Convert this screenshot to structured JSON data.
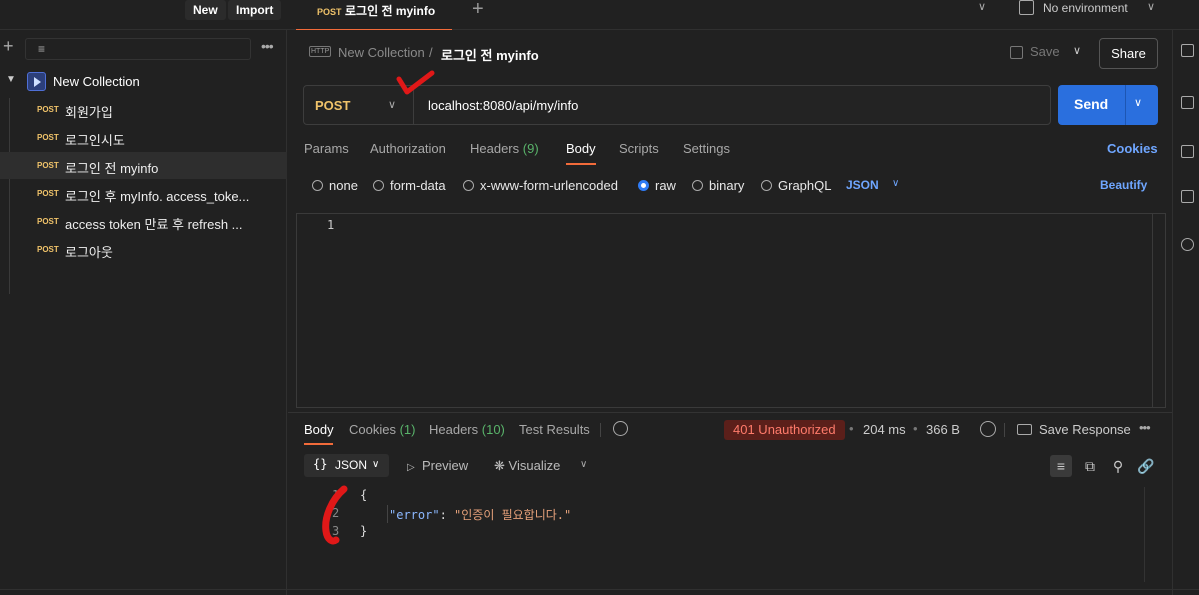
{
  "topbar": {
    "new_label": "New",
    "import_label": "Import",
    "active_tab": {
      "method": "POST",
      "title": "로그인 전 myinfo"
    },
    "environment": "No environment"
  },
  "sidebar": {
    "collection_name": "New Collection",
    "requests": [
      {
        "method": "POST",
        "name": "회원가입"
      },
      {
        "method": "POST",
        "name": "로그인시도"
      },
      {
        "method": "POST",
        "name": "로그인 전 myinfo"
      },
      {
        "method": "POST",
        "name": "로그인 후 myInfo. access_toke..."
      },
      {
        "method": "POST",
        "name": "access token 만료 후 refresh ..."
      },
      {
        "method": "POST",
        "name": "로그아웃"
      }
    ]
  },
  "breadcrumb": {
    "icon": "HTTP",
    "collection": "New Collection",
    "separator": "/",
    "request": "로그인 전 myinfo"
  },
  "actions": {
    "save_label": "Save",
    "share_label": "Share"
  },
  "request": {
    "method": "POST",
    "url": "localhost:8080/api/my/info",
    "send_label": "Send"
  },
  "request_tabs": {
    "params": "Params",
    "authorization": "Authorization",
    "headers": "Headers",
    "headers_count": "(9)",
    "body": "Body",
    "scripts": "Scripts",
    "settings": "Settings",
    "cookies": "Cookies"
  },
  "body_types": {
    "none": "none",
    "form_data": "form-data",
    "urlencoded": "x-www-form-urlencoded",
    "raw": "raw",
    "binary": "binary",
    "graphql": "GraphQL",
    "selected": "raw",
    "language": "JSON",
    "beautify": "Beautify"
  },
  "editor": {
    "line_number": "1"
  },
  "response_tabs": {
    "body": "Body",
    "cookies": "Cookies",
    "cookies_count": "(1)",
    "headers": "Headers",
    "headers_count": "(10)",
    "test_results": "Test Results"
  },
  "response_meta": {
    "status": "401 Unauthorized",
    "time": "204 ms",
    "size": "366 B",
    "save_response": "Save Response",
    "status_color": "#ff7b6b"
  },
  "response_toolbar": {
    "format_braces": "{}",
    "format": "JSON",
    "preview": "Preview",
    "visualize": "Visualize"
  },
  "response_body": {
    "lines": [
      "1",
      "2",
      "3"
    ],
    "open": "{",
    "key": "\"error\"",
    "colon": ": ",
    "value": "\"인증이 필요합니다.\"",
    "close": "}"
  }
}
